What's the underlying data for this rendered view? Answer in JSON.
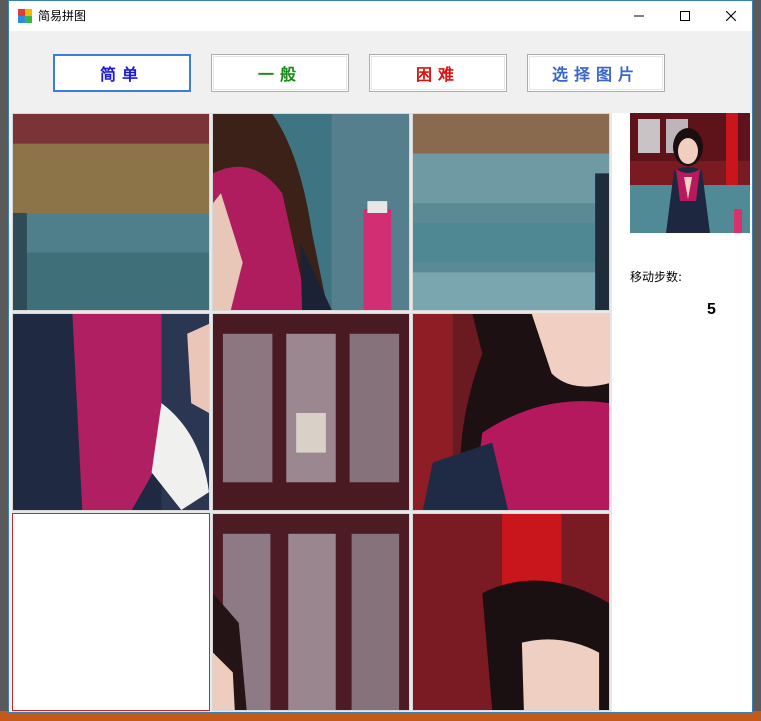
{
  "window": {
    "title": "简易拼图"
  },
  "toolbar": {
    "easy_label": "简单",
    "normal_label": "一般",
    "hard_label": "困难",
    "pick_label": "选择图片",
    "colors": {
      "easy": "#1a1ad6",
      "normal": "#1a8a1a",
      "hard": "#e01010",
      "pick": "#3a66cc"
    }
  },
  "board": {
    "rows": 3,
    "cols": 3,
    "layout": [
      [
        "bokeh-steps-left",
        "hands-scarf",
        "steps-pink-bottle"
      ],
      [
        "arm-scarf-sleeve",
        "window-lattice",
        "face-scarf"
      ],
      [
        "empty",
        "window-lattice-edge",
        "red-pillar-hair"
      ]
    ]
  },
  "side": {
    "steps_label": "移动步数:",
    "steps_value": "5"
  }
}
